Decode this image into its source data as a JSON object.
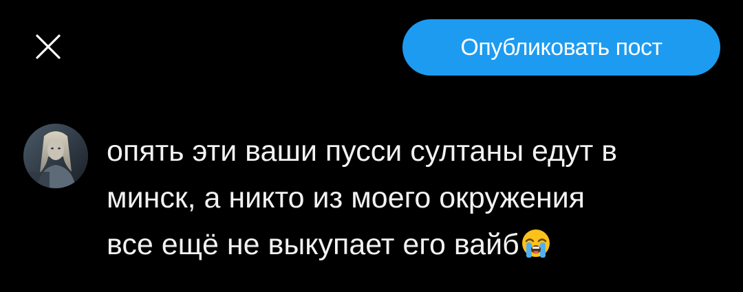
{
  "compose": {
    "close_icon": "close-icon",
    "publish_label": "Опубликовать пост",
    "accent_color": "#1d9bf0",
    "background_color": "#000000"
  },
  "post": {
    "avatar_icon": "user-avatar",
    "lines": [
      "опять эти ваши пусси султаны едут в",
      "минск, а никто из моего окружения",
      "все ещё не выкупает его вайб"
    ],
    "emoji": "😭",
    "emoji_icon": "loudly-crying-face-icon"
  }
}
